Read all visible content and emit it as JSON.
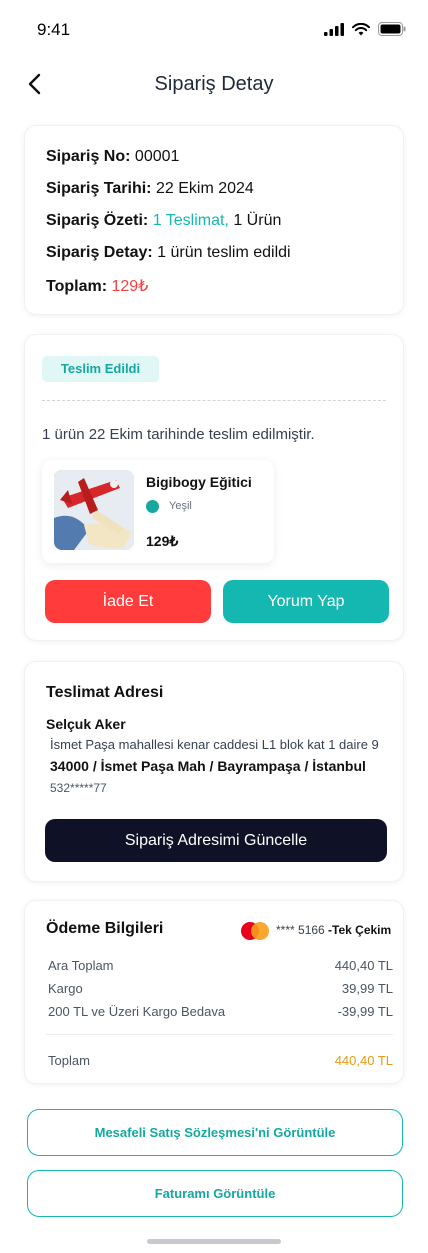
{
  "status_bar": {
    "time": "9:41"
  },
  "header": {
    "title": "Sipariş Detay"
  },
  "summary": {
    "order_no_label": "Sipariş No:",
    "order_no": "00001",
    "order_date_label": "Sipariş Tarihi:",
    "order_date": "22 Ekim 2024",
    "order_summary_label": "Sipariş Özeti:",
    "order_summary_delivery": "1 Teslimat,",
    "order_summary_items": " 1 Ürün",
    "order_detail_label": "Sipariş Detay:",
    "order_detail": "1 ürün teslim edildi",
    "total_label": "Toplam:",
    "total": "129₺"
  },
  "delivery": {
    "status_badge": "Teslim Edildi",
    "message": "1 ürün 22 Ekim tarihinde teslim edilmiştir.",
    "product": {
      "name": "Bigibogy Eğitici",
      "color": "Yeşil",
      "price": "129₺"
    },
    "return_label": "İade Et",
    "review_label": "Yorum Yap"
  },
  "address": {
    "title": "Teslimat Adresi",
    "name": "Selçuk Aker",
    "line": "İsmet Paşa mahallesi kenar caddesi L1 blok kat 1 daire 9",
    "city": "34000 / İsmet Paşa Mah / Bayrampaşa / İstanbul",
    "phone": "532*****77",
    "update_label": "Sipariş Adresimi Güncelle"
  },
  "payment": {
    "title": "Ödeme Bilgileri",
    "card_number": "**** 5166",
    "card_type": " -Tek Çekim",
    "rows": [
      {
        "label": "Ara Toplam",
        "value": "440,40 TL"
      },
      {
        "label": "Kargo",
        "value": "39,99 TL"
      },
      {
        "label": "200 TL ve Üzeri Kargo Bedava",
        "value": "-39,99 TL"
      }
    ],
    "total_label": "Toplam",
    "total_value": "440,40 TL"
  },
  "links": {
    "contract_label": "Mesafeli Satış Sözleşmesi'ni Görüntüle",
    "invoice_label": "Faturamı Görüntüle"
  },
  "colors": {
    "accent": "#14b8b0",
    "danger": "#ff3b3b",
    "dark": "#0f1226",
    "total_highlight": "#e69a16"
  }
}
